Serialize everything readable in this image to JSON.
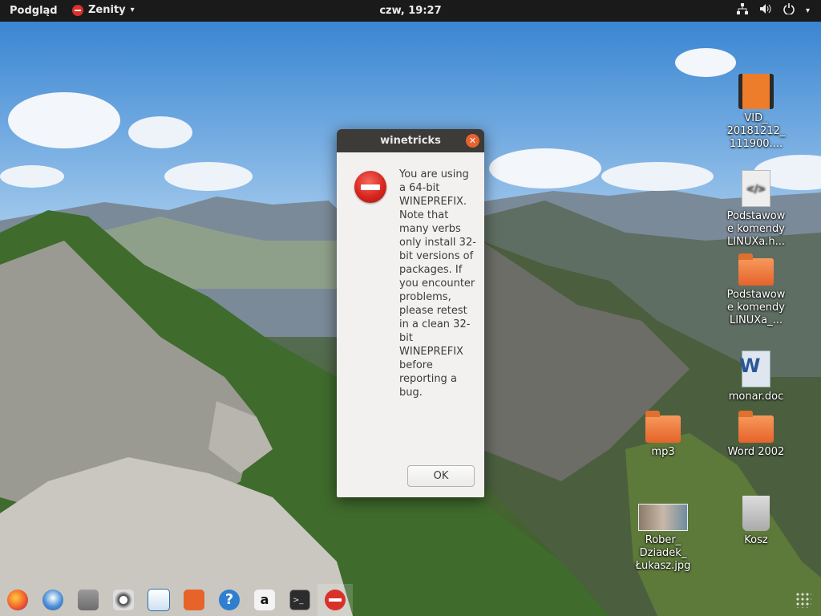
{
  "topbar": {
    "activities": "Podgląd",
    "app_name": "Zenity",
    "app_icon": "stop-icon",
    "clock": "czw, 19:27",
    "indicators": [
      "network-icon",
      "volume-icon",
      "power-icon",
      "chevron-down-icon"
    ]
  },
  "dialog": {
    "title": "winetricks",
    "close_icon": "close-icon",
    "icon": "error-icon",
    "message": "You are using a 64-bit WINEPREFIX. Note that many verbs only install 32-bit versions of packages. If you encounter problems, please retest in a clean 32-bit WINEPREFIX before reporting a bug.",
    "ok_label": "OK"
  },
  "desktop_icons": [
    {
      "label": "VID_\n20181212_\n111900....",
      "icon": "video-file-icon"
    },
    {
      "label": "Podstawow\ne komendy\nLINUXa.h...",
      "icon": "html-file-icon"
    },
    {
      "label": "Podstawow\ne komendy\nLINUXa_...",
      "icon": "folder-icon"
    },
    {
      "label": "monar.doc",
      "icon": "doc-file-icon"
    },
    {
      "label": "mp3",
      "icon": "folder-icon"
    },
    {
      "label": "Word 2002",
      "icon": "folder-icon"
    },
    {
      "label": "Rober_\nDziadek_\nŁukasz.jpg",
      "icon": "image-file-icon"
    },
    {
      "label": "Kosz",
      "icon": "trash-icon"
    }
  ],
  "dock": [
    "firefox-icon",
    "thunderbird-icon",
    "files-icon",
    "rhythmbox-icon",
    "libreoffice-writer-icon",
    "software-center-icon",
    "help-icon",
    "amazon-icon",
    "terminal-icon",
    "zenity-stop-icon"
  ],
  "colors": {
    "topbar": "#1a1a1a",
    "dialog_title": "#3d3b37",
    "close": "#e8622e",
    "error_red": "#d8261f",
    "folder": "#ee7d2b"
  }
}
